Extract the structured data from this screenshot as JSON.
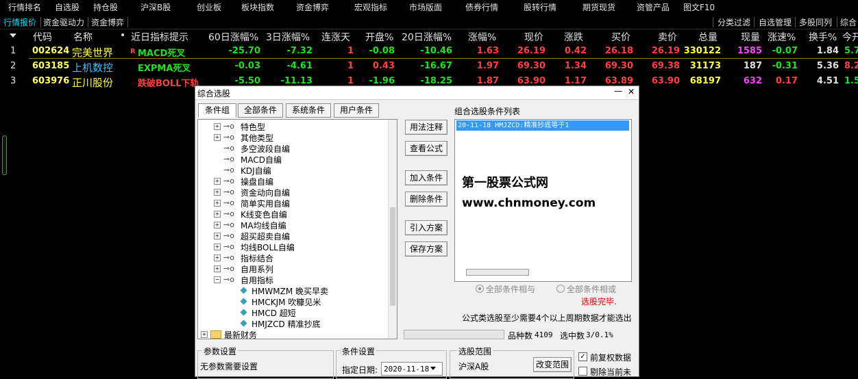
{
  "top_menu": [
    "行情排名",
    "自选股",
    "持仓股",
    "沪深B股",
    "创业板",
    "板块指数",
    "资金博弈",
    "宏观指标",
    "市场版面",
    "债券行情",
    "股转行情",
    "期货现货",
    "资管产品",
    "图文F10"
  ],
  "sub_tabs": [
    "行情报价",
    "资金驱动力",
    "资金博弈"
  ],
  "right_tabs": [
    "分类过滤",
    "自选管理",
    "多股同列",
    "综合"
  ],
  "columns": [
    "代码",
    "名称",
    "•",
    "近日指标提示",
    "60日涨幅%",
    "3日涨幅%",
    "连涨天",
    "开盘%",
    "20日涨幅%",
    "涨幅%",
    "现价",
    "涨跌",
    "买价",
    "卖价",
    "总量",
    "现量",
    "涨速%",
    "换手%",
    "今开"
  ],
  "rows": [
    {
      "num": "1",
      "code": "002624",
      "name": "完美世界",
      "flag": "R",
      "signal": "MACD死叉",
      "d60": "-25.70",
      "d3": "-7.32",
      "up": "1",
      "open": "-0.08",
      "d20": "-10.46",
      "chg": "1.63",
      "price": "26.19",
      "diff": "0.42",
      "bid": "26.18",
      "ask": "26.19",
      "vol": "330122",
      "cur": "1585",
      "speed": "-0.07",
      "turn": "1.84",
      "today": "5.7"
    },
    {
      "num": "2",
      "code": "603185",
      "name": "上机数控",
      "flag": "",
      "signal": "EXPMA死叉",
      "d60": "-0.03",
      "d3": "-4.61",
      "up": "1",
      "open": "0.43",
      "d20": "-16.67",
      "chg": "1.97",
      "price": "69.30",
      "diff": "1.34",
      "bid": "69.30",
      "ask": "69.38",
      "vol": "31173",
      "cur": "187",
      "speed": "-0.31",
      "turn": "5.36",
      "today": "8.2"
    },
    {
      "num": "3",
      "code": "603976",
      "name": "正川股份",
      "flag": "",
      "signal": "跌破BOLL下轨",
      "d60": "-5.50",
      "d3": "-11.13",
      "up": "1",
      "open": "-1.96",
      "d20": "-18.25",
      "chg": "1.87",
      "price": "63.90",
      "diff": "1.17",
      "bid": "63.89",
      "ask": "63.90",
      "vol": "68197",
      "cur": "632",
      "speed": "0.17",
      "turn": "4.51",
      "today": "1.5"
    }
  ],
  "dialog": {
    "title": "综合选股",
    "minimize": "—",
    "close": "✕",
    "tabs": [
      "条件组",
      "全部条件",
      "系统条件",
      "用户条件"
    ],
    "tree": [
      {
        "label": "特色型",
        "level": 1,
        "exp": "+"
      },
      {
        "label": "其他类型",
        "level": 1,
        "exp": "+"
      },
      {
        "label": "多空波段自编",
        "level": 1,
        "exp": ""
      },
      {
        "label": "MACD自编",
        "level": 1,
        "exp": ""
      },
      {
        "label": "KDJ自编",
        "level": 1,
        "exp": ""
      },
      {
        "label": "操盘自编",
        "level": 1,
        "exp": "+"
      },
      {
        "label": "资金动向自编",
        "level": 1,
        "exp": "+"
      },
      {
        "label": "简单实用自编",
        "level": 1,
        "exp": "+"
      },
      {
        "label": "K线变色自编",
        "level": 1,
        "exp": "+"
      },
      {
        "label": "MA均线自编",
        "level": 1,
        "exp": "+"
      },
      {
        "label": "超买超卖自编",
        "level": 1,
        "exp": "+"
      },
      {
        "label": "均线BOLL自编",
        "level": 1,
        "exp": "+"
      },
      {
        "label": "指标结合",
        "level": 1,
        "exp": "+"
      },
      {
        "label": "自用系列",
        "level": 1,
        "exp": "+"
      },
      {
        "label": "自用指标",
        "level": 1,
        "exp": "−"
      },
      {
        "label": "HMWMZM 晚买早卖",
        "level": 2,
        "exp": ""
      },
      {
        "label": "HMCKJM 吹糠见米",
        "level": 2,
        "exp": ""
      },
      {
        "label": "HMCD 超短",
        "level": 2,
        "exp": ""
      },
      {
        "label": "HMJZCD 精准抄底",
        "level": 2,
        "exp": ""
      },
      {
        "label": "最新财务",
        "level": 0,
        "exp": "+"
      }
    ],
    "buttons": [
      "用法注释",
      "查看公式",
      "加入条件",
      "删除条件",
      "引入方案",
      "保存方案"
    ],
    "list_title": "组合选股条件列表",
    "list_items": [
      "20-11-18 HMJZCD:精准抄底等于1"
    ],
    "watermark_cn": "第一股票公式网",
    "watermark_url": "www.chnmoney.com",
    "radio_and": "全部条件相与",
    "radio_or": "全部条件相或",
    "status": "选股完毕.",
    "note": "公式类选股至少需要4个以上周期数据才能选出",
    "count_label": "品种数",
    "count_value": "4109",
    "selected_label": "选中数",
    "selected_value": "3/0.1%",
    "param_title": "参数设置",
    "param_text": "无参数需要设置",
    "cond_title": "条件设置",
    "date_label": "指定日期:",
    "date_value": "2020-11-18",
    "range_title": "选股范围",
    "range_value": "沪深A股",
    "range_button": "改变范围",
    "chk1": "前复权数据",
    "chk2": "剔除当前未"
  }
}
